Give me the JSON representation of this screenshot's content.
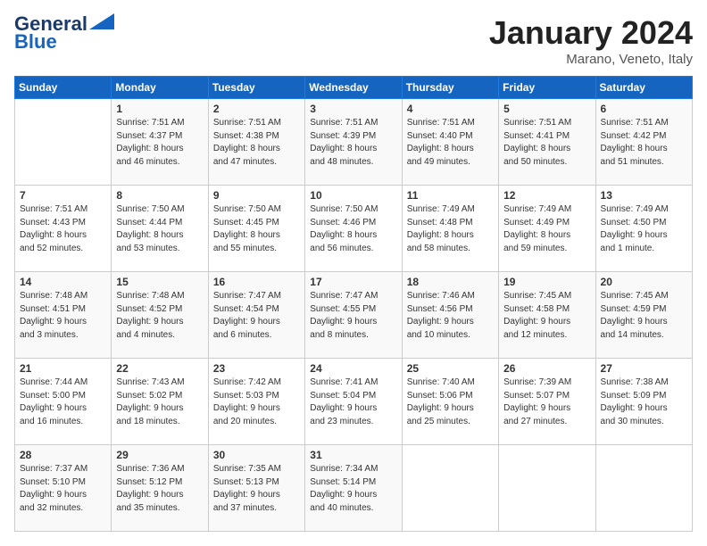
{
  "header": {
    "logo_line1": "General",
    "logo_line2": "Blue",
    "month": "January 2024",
    "location": "Marano, Veneto, Italy"
  },
  "weekdays": [
    "Sunday",
    "Monday",
    "Tuesday",
    "Wednesday",
    "Thursday",
    "Friday",
    "Saturday"
  ],
  "weeks": [
    [
      {
        "day": "",
        "info": ""
      },
      {
        "day": "1",
        "info": "Sunrise: 7:51 AM\nSunset: 4:37 PM\nDaylight: 8 hours\nand 46 minutes."
      },
      {
        "day": "2",
        "info": "Sunrise: 7:51 AM\nSunset: 4:38 PM\nDaylight: 8 hours\nand 47 minutes."
      },
      {
        "day": "3",
        "info": "Sunrise: 7:51 AM\nSunset: 4:39 PM\nDaylight: 8 hours\nand 48 minutes."
      },
      {
        "day": "4",
        "info": "Sunrise: 7:51 AM\nSunset: 4:40 PM\nDaylight: 8 hours\nand 49 minutes."
      },
      {
        "day": "5",
        "info": "Sunrise: 7:51 AM\nSunset: 4:41 PM\nDaylight: 8 hours\nand 50 minutes."
      },
      {
        "day": "6",
        "info": "Sunrise: 7:51 AM\nSunset: 4:42 PM\nDaylight: 8 hours\nand 51 minutes."
      }
    ],
    [
      {
        "day": "7",
        "info": "Sunrise: 7:51 AM\nSunset: 4:43 PM\nDaylight: 8 hours\nand 52 minutes."
      },
      {
        "day": "8",
        "info": "Sunrise: 7:50 AM\nSunset: 4:44 PM\nDaylight: 8 hours\nand 53 minutes."
      },
      {
        "day": "9",
        "info": "Sunrise: 7:50 AM\nSunset: 4:45 PM\nDaylight: 8 hours\nand 55 minutes."
      },
      {
        "day": "10",
        "info": "Sunrise: 7:50 AM\nSunset: 4:46 PM\nDaylight: 8 hours\nand 56 minutes."
      },
      {
        "day": "11",
        "info": "Sunrise: 7:49 AM\nSunset: 4:48 PM\nDaylight: 8 hours\nand 58 minutes."
      },
      {
        "day": "12",
        "info": "Sunrise: 7:49 AM\nSunset: 4:49 PM\nDaylight: 8 hours\nand 59 minutes."
      },
      {
        "day": "13",
        "info": "Sunrise: 7:49 AM\nSunset: 4:50 PM\nDaylight: 9 hours\nand 1 minute."
      }
    ],
    [
      {
        "day": "14",
        "info": "Sunrise: 7:48 AM\nSunset: 4:51 PM\nDaylight: 9 hours\nand 3 minutes."
      },
      {
        "day": "15",
        "info": "Sunrise: 7:48 AM\nSunset: 4:52 PM\nDaylight: 9 hours\nand 4 minutes."
      },
      {
        "day": "16",
        "info": "Sunrise: 7:47 AM\nSunset: 4:54 PM\nDaylight: 9 hours\nand 6 minutes."
      },
      {
        "day": "17",
        "info": "Sunrise: 7:47 AM\nSunset: 4:55 PM\nDaylight: 9 hours\nand 8 minutes."
      },
      {
        "day": "18",
        "info": "Sunrise: 7:46 AM\nSunset: 4:56 PM\nDaylight: 9 hours\nand 10 minutes."
      },
      {
        "day": "19",
        "info": "Sunrise: 7:45 AM\nSunset: 4:58 PM\nDaylight: 9 hours\nand 12 minutes."
      },
      {
        "day": "20",
        "info": "Sunrise: 7:45 AM\nSunset: 4:59 PM\nDaylight: 9 hours\nand 14 minutes."
      }
    ],
    [
      {
        "day": "21",
        "info": "Sunrise: 7:44 AM\nSunset: 5:00 PM\nDaylight: 9 hours\nand 16 minutes."
      },
      {
        "day": "22",
        "info": "Sunrise: 7:43 AM\nSunset: 5:02 PM\nDaylight: 9 hours\nand 18 minutes."
      },
      {
        "day": "23",
        "info": "Sunrise: 7:42 AM\nSunset: 5:03 PM\nDaylight: 9 hours\nand 20 minutes."
      },
      {
        "day": "24",
        "info": "Sunrise: 7:41 AM\nSunset: 5:04 PM\nDaylight: 9 hours\nand 23 minutes."
      },
      {
        "day": "25",
        "info": "Sunrise: 7:40 AM\nSunset: 5:06 PM\nDaylight: 9 hours\nand 25 minutes."
      },
      {
        "day": "26",
        "info": "Sunrise: 7:39 AM\nSunset: 5:07 PM\nDaylight: 9 hours\nand 27 minutes."
      },
      {
        "day": "27",
        "info": "Sunrise: 7:38 AM\nSunset: 5:09 PM\nDaylight: 9 hours\nand 30 minutes."
      }
    ],
    [
      {
        "day": "28",
        "info": "Sunrise: 7:37 AM\nSunset: 5:10 PM\nDaylight: 9 hours\nand 32 minutes."
      },
      {
        "day": "29",
        "info": "Sunrise: 7:36 AM\nSunset: 5:12 PM\nDaylight: 9 hours\nand 35 minutes."
      },
      {
        "day": "30",
        "info": "Sunrise: 7:35 AM\nSunset: 5:13 PM\nDaylight: 9 hours\nand 37 minutes."
      },
      {
        "day": "31",
        "info": "Sunrise: 7:34 AM\nSunset: 5:14 PM\nDaylight: 9 hours\nand 40 minutes."
      },
      {
        "day": "",
        "info": ""
      },
      {
        "day": "",
        "info": ""
      },
      {
        "day": "",
        "info": ""
      }
    ]
  ]
}
